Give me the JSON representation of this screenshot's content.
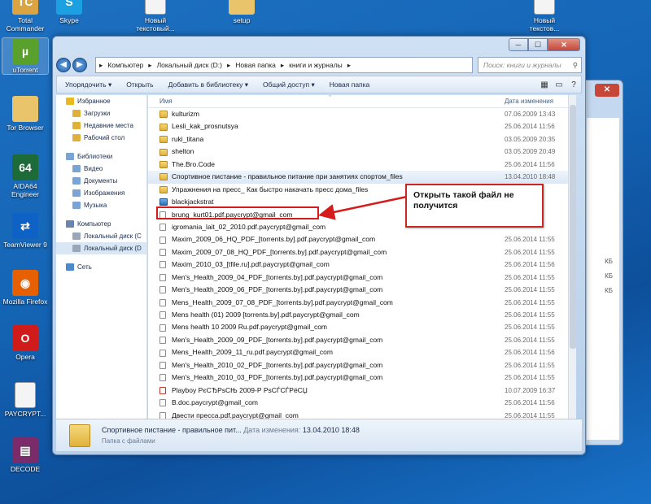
{
  "desktop": {
    "icons": [
      {
        "label": "Total Commander",
        "symbol": "TC",
        "color": "#d9a441"
      },
      {
        "label": "Skype",
        "symbol": "S",
        "color": "#1ba1e2"
      },
      {
        "label": "Новый текстовый...",
        "symbol": "",
        "color": "#f4f4f4"
      },
      {
        "label": "setup",
        "symbol": "",
        "color": "#e9c46a"
      },
      {
        "label": "Новый текстов...",
        "symbol": "",
        "color": "#f4f4f4"
      },
      {
        "label": "uTorrent",
        "symbol": "µ",
        "color": "#5aa02c"
      },
      {
        "label": "Tor Browser",
        "symbol": "",
        "color": "#e9c46a"
      },
      {
        "label": "AIDA64 Engineer",
        "symbol": "64",
        "color": "#1e6b3a"
      },
      {
        "label": "TeamViewer 9",
        "symbol": "⇄",
        "color": "#0e62c6"
      },
      {
        "label": "Mozilla Firefox",
        "symbol": "◉",
        "color": "#e66000"
      },
      {
        "label": "Opera",
        "symbol": "O",
        "color": "#d01b1b"
      },
      {
        "label": "PAYCRYPT...",
        "symbol": "",
        "color": "#f4f4f4"
      },
      {
        "label": "DECODE",
        "symbol": "▤",
        "color": "#7a2b6a"
      }
    ]
  },
  "bg_window": {
    "close_symbol": "✕",
    "sizes": [
      "КБ",
      "КБ",
      "КБ"
    ]
  },
  "window": {
    "btn_min": "─",
    "btn_max": "☐",
    "btn_close": "✕",
    "nav_back": "◀",
    "nav_forward": "▶",
    "breadcrumb": [
      "Компьютер",
      "Локальный диск (D:)",
      "Новая папка",
      "книги и журналы"
    ],
    "breadcrumb_sep": "▸",
    "search_placeholder": "Поиск: книги и журналы",
    "search_icon": "⚲",
    "toolbar": {
      "organize": "Упорядочить ▾",
      "open": "Открыть",
      "add_library": "Добавить в библиотеку ▾",
      "share": "Общий доступ ▾",
      "new_folder": "Новая папка",
      "view_icon": "▦",
      "pane_icon": "▭",
      "help_icon": "?"
    },
    "nav": [
      {
        "label": "Избранное",
        "kind": "star"
      },
      {
        "label": "Загрузки",
        "kind": "folder"
      },
      {
        "label": "Недавние места",
        "kind": "folder"
      },
      {
        "label": "Рабочий стол",
        "kind": "folder"
      },
      {
        "label": "",
        "kind": "gap"
      },
      {
        "label": "Библиотеки",
        "kind": "lib"
      },
      {
        "label": "Видео",
        "kind": "lib"
      },
      {
        "label": "Документы",
        "kind": "lib"
      },
      {
        "label": "Изображения",
        "kind": "lib"
      },
      {
        "label": "Музыка",
        "kind": "lib"
      },
      {
        "label": "",
        "kind": "gap"
      },
      {
        "label": "Компьютер",
        "kind": "pc"
      },
      {
        "label": "Локальный диск (C",
        "kind": "drive"
      },
      {
        "label": "Локальный диск (D",
        "kind": "drive",
        "selected": true
      },
      {
        "label": "",
        "kind": "gap"
      },
      {
        "label": "Сеть",
        "kind": "net"
      }
    ],
    "columns": {
      "name": "Имя",
      "date": "Дата изменения",
      "sort_arrow": "^"
    },
    "files": [
      {
        "name": "kulturizm",
        "date": "07.06.2009 13:43",
        "kind": "folder"
      },
      {
        "name": "Lesli_kak_prosnutsya",
        "date": "25.06.2014 11:56",
        "kind": "folder"
      },
      {
        "name": "ruki_titana",
        "date": "03.05.2009 20:35",
        "kind": "folder"
      },
      {
        "name": "shelton",
        "date": "03.05.2009 20:49",
        "kind": "folder"
      },
      {
        "name": "The.Bro.Code",
        "date": "25.06.2014 11:56",
        "kind": "folder"
      },
      {
        "name": "Спортивное пистание - правильное питание при занятиях спортом_files",
        "date": "13.04.2010 18:48",
        "kind": "folder",
        "selected": true
      },
      {
        "name": "Упражнения на пресс_ Как быстро накачать пресс дома_files",
        "date": "",
        "kind": "folder"
      },
      {
        "name": "blackjackstrat",
        "date": "",
        "kind": "app"
      },
      {
        "name": "brung_kurt01.pdf.paycrypt@gmail_com",
        "date": "",
        "kind": "file"
      },
      {
        "name": "igromania_lait_02_2010.pdf.paycrypt@gmail_com",
        "date": "",
        "kind": "file"
      },
      {
        "name": "Maxim_2009_06_HQ_PDF_[torrents.by].pdf.paycrypt@gmail_com",
        "date": "25.06.2014 11:55",
        "kind": "file"
      },
      {
        "name": "Maxim_2009_07_08_HQ_PDF_[torrents.by].pdf.paycrypt@gmail_com",
        "date": "25.06.2014 11:55",
        "kind": "file"
      },
      {
        "name": "Maxim_2010_03_[tfile.ru].pdf.paycrypt@gmail_com",
        "date": "25.06.2014 11:56",
        "kind": "file"
      },
      {
        "name": "Men's_Health_2009_04_PDF_[torrents.by].pdf.paycrypt@gmail_com",
        "date": "25.06.2014 11:55",
        "kind": "file"
      },
      {
        "name": "Men's_Health_2009_06_PDF_[torrents.by].pdf.paycrypt@gmail_com",
        "date": "25.06.2014 11:55",
        "kind": "file"
      },
      {
        "name": "Mens_Health_2009_07_08_PDF_[torrents.by].pdf.paycrypt@gmail_com",
        "date": "25.06.2014 11:55",
        "kind": "file"
      },
      {
        "name": "Mens health  (01) 2009 [torrents.by].pdf.paycrypt@gmail_com",
        "date": "25.06.2014 11:55",
        "kind": "file"
      },
      {
        "name": "Mens health 10 2009 Ru.pdf.paycrypt@gmail_com",
        "date": "25.06.2014 11:55",
        "kind": "file"
      },
      {
        "name": "Men's_Health_2009_09_PDF_[torrents.by].pdf.paycrypt@gmail_com",
        "date": "25.06.2014 11:55",
        "kind": "file"
      },
      {
        "name": "Mens_Health_2009_11_ru.pdf.paycrypt@gmail_com",
        "date": "25.06.2014 11:56",
        "kind": "file"
      },
      {
        "name": "Men's_Health_2010_02_PDF_[torrents.by].pdf.paycrypt@gmail_com",
        "date": "25.06.2014 11:55",
        "kind": "file"
      },
      {
        "name": "Men's_Health_2010_03_PDF_[torrents.by].pdf.paycrypt@gmail_com",
        "date": "25.06.2014 11:55",
        "kind": "file"
      },
      {
        "name": "Playboy РєСЂРѕСЊ 2009-Р РѕСЃСЃРёСЏ",
        "date": "10.07.2009 16:37",
        "kind": "pdf"
      },
      {
        "name": "B.doc.paycrypt@gmail_com",
        "date": "25.06.2014 11:56",
        "kind": "file"
      },
      {
        "name": "Двести пресса.pdf.paycrypt@gmail_com",
        "date": "25.06.2014 11:55",
        "kind": "file"
      },
      {
        "name": "",
        "date": "25.06.2014 11:55",
        "kind": "file"
      }
    ],
    "details": {
      "name": "Спортивное пистание - правильное пит...",
      "date_label": "Дата изменения:",
      "date_value": "13.04.2010 18:48",
      "type": "Папка с файлами"
    }
  },
  "annotation": {
    "callout_text": "Открыть такой файл не получится",
    "color": "#d61b1b"
  }
}
